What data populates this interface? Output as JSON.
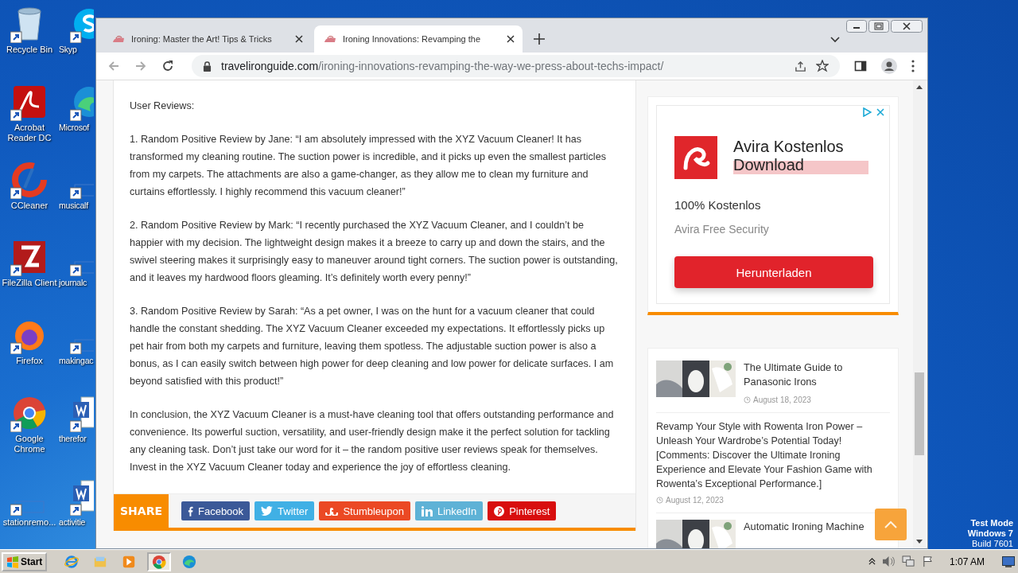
{
  "desktop": {
    "icon_columns": [
      [
        {
          "label": "Recycle Bin",
          "kind": "recycle"
        },
        {
          "label": "Acrobat Reader DC",
          "kind": "acrobat"
        },
        {
          "label": "CCleaner",
          "kind": "ccleaner"
        },
        {
          "label": "FileZilla Client",
          "kind": "filezilla"
        },
        {
          "label": "Firefox",
          "kind": "firefox"
        },
        {
          "label": "Google Chrome",
          "kind": "chrome"
        },
        {
          "label": "stationremo...",
          "kind": "blank"
        }
      ],
      [
        {
          "label": "Skyp",
          "kind": "skype"
        },
        {
          "label": "Microsof",
          "kind": "edge"
        },
        {
          "label": "musicalf",
          "kind": "blank"
        },
        {
          "label": "journalc",
          "kind": "blank"
        },
        {
          "label": "makingac",
          "kind": "blank"
        },
        {
          "label": "therefor",
          "kind": "word"
        },
        {
          "label": "activitie",
          "kind": "word"
        }
      ]
    ],
    "test_mode": [
      "Test Mode",
      "Windows 7",
      "Build 7601"
    ]
  },
  "browser": {
    "tabs": [
      {
        "title": "Ironing: Master the Art! Tips & Tricks",
        "selected": false
      },
      {
        "title": "Ironing Innovations: Revamping the",
        "selected": true
      }
    ],
    "url_domain": "travelironguide.com",
    "url_path": "/ironing-innovations-revamping-the-way-we-press-about-techs-impact/"
  },
  "article": {
    "paragraphs": [
      "User Reviews:",
      "1. Random Positive Review by Jane: “I am absolutely impressed with the XYZ Vacuum Cleaner! It has transformed my cleaning routine. The suction power is incredible, and it picks up even the smallest particles from my carpets. The attachments are also a game-changer, as they allow me to clean my furniture and curtains effortlessly. I highly recommend this vacuum cleaner!”",
      "2. Random Positive Review by Mark: “I recently purchased the XYZ Vacuum Cleaner, and I couldn’t be happier with my decision. The lightweight design makes it a breeze to carry up and down the stairs, and the swivel steering makes it surprisingly easy to maneuver around tight corners. The suction power is outstanding, and it leaves my hardwood floors gleaming. It’s definitely worth every penny!”",
      "3. Random Positive Review by Sarah: “As a pet owner, I was on the hunt for a vacuum cleaner that could handle the constant shedding. The XYZ Vacuum Cleaner exceeded my expectations. It effortlessly picks up pet hair from both my carpets and furniture, leaving them spotless. The adjustable suction power is also a bonus, as I can easily switch between high power for deep cleaning and low power for delicate surfaces. I am beyond satisfied with this product!”",
      "In conclusion, the XYZ Vacuum Cleaner is a must-have cleaning tool that offers outstanding performance and convenience. Its powerful suction, versatility, and user-friendly design make it the perfect solution for tackling any cleaning task. Don’t just take our word for it – the random positive user reviews speak for themselves. Invest in the XYZ Vacuum Cleaner today and experience the joy of effortless cleaning."
    ],
    "share": {
      "label": "SHARE",
      "buttons": [
        {
          "label": "Facebook",
          "kind": "facebook",
          "color": "#3b5998"
        },
        {
          "label": "Twitter",
          "kind": "twitter",
          "color": "#40b0e5"
        },
        {
          "label": "Stumbleupon",
          "kind": "stumbleupon",
          "color": "#eb4924"
        },
        {
          "label": "LinkedIn",
          "kind": "linkedin",
          "color": "#5eb2d6"
        },
        {
          "label": "Pinterest",
          "kind": "pinterest",
          "color": "#d80e0e"
        }
      ]
    }
  },
  "ad": {
    "title": "Avira Kostenlos Download",
    "subtitle": "100% Kostenlos",
    "brand": "Avira Free Security",
    "button": "Herunterladen"
  },
  "sidebar_posts": [
    {
      "title": "The Ultimate Guide to Panasonic Irons",
      "date": "August 18, 2023",
      "kind": "thumb"
    },
    {
      "title": "Revamp Your Style with Rowenta Iron Power – Unleash Your Wardrobe’s Potential Today! [Comments: Discover the Ultimate Ironing Experience and Elevate Your Fashion Game with Rowenta’s Exceptional Performance.]",
      "date": "August 12, 2023",
      "kind": "text"
    },
    {
      "title": "Automatic Ironing Machine",
      "kind": "thumb"
    }
  ],
  "taskbar": {
    "start": "Start",
    "apps": [
      {
        "kind": "ie",
        "selected": false
      },
      {
        "kind": "explorer",
        "selected": false
      },
      {
        "kind": "media",
        "selected": false
      },
      {
        "kind": "chrome",
        "selected": true
      },
      {
        "kind": "edge",
        "selected": false
      }
    ],
    "clock": "1:07 AM"
  }
}
